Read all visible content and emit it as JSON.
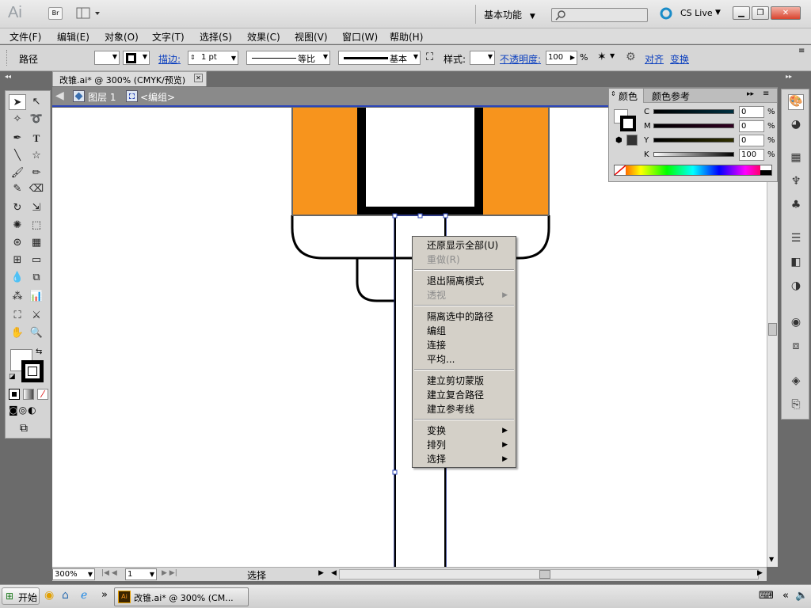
{
  "app": {
    "logo": "Ai",
    "bridge": "Br",
    "workspace": "基本功能",
    "cslive": "CS Live"
  },
  "menubar": [
    "文件(F)",
    "编辑(E)",
    "对象(O)",
    "文字(T)",
    "选择(S)",
    "效果(C)",
    "视图(V)",
    "窗口(W)",
    "帮助(H)"
  ],
  "controlbar": {
    "path_label": "路径",
    "stroke_link": "描边:",
    "stroke_weight": "1 pt",
    "profile": "等比",
    "brush": "基本",
    "style_label": "样式:",
    "opacity_link": "不透明度:",
    "opacity_value": "100",
    "percent": "%",
    "align_link": "对齐",
    "transform_link": "变换"
  },
  "document": {
    "tab_title": "改锥.ai* @ 300% (CMYK/预览)",
    "layer": "图层 1",
    "group": "<编组>",
    "zoom": "300%",
    "page": "1",
    "status": "选择"
  },
  "color_panel": {
    "tab_color": "颜色",
    "tab_guide": "颜色参考",
    "channels": [
      {
        "label": "C",
        "value": "0",
        "color": "#00aeef"
      },
      {
        "label": "M",
        "value": "0",
        "color": "#ec008c"
      },
      {
        "label": "Y",
        "value": "0",
        "color": "#fff200"
      },
      {
        "label": "K",
        "value": "100",
        "color": "#000000"
      }
    ],
    "percent": "%"
  },
  "context_menu": {
    "items": [
      {
        "label": "还原显示全部(U)",
        "enabled": true,
        "submenu": false
      },
      {
        "label": "重做(R)",
        "enabled": false,
        "submenu": false
      },
      {
        "separator": true
      },
      {
        "label": "退出隔离模式",
        "enabled": true,
        "submenu": false
      },
      {
        "label": "透视",
        "enabled": false,
        "submenu": true
      },
      {
        "separator": true
      },
      {
        "label": "隔离选中的路径",
        "enabled": true,
        "submenu": false
      },
      {
        "label": "编组",
        "enabled": true,
        "submenu": false
      },
      {
        "label": "连接",
        "enabled": true,
        "submenu": false
      },
      {
        "label": "平均...",
        "enabled": true,
        "submenu": false
      },
      {
        "separator": true
      },
      {
        "label": "建立剪切蒙版",
        "enabled": true,
        "submenu": false
      },
      {
        "label": "建立复合路径",
        "enabled": true,
        "submenu": false
      },
      {
        "label": "建立参考线",
        "enabled": true,
        "submenu": false
      },
      {
        "separator": true
      },
      {
        "label": "变换",
        "enabled": true,
        "submenu": true
      },
      {
        "label": "排列",
        "enabled": true,
        "submenu": true
      },
      {
        "label": "选择",
        "enabled": true,
        "submenu": true
      }
    ]
  },
  "taskbar": {
    "start": "开始",
    "window_title": "改锥.ai* @ 300% (CM...",
    "more": "»"
  },
  "colors": {
    "orange": "#f7941d",
    "isolation_bar": "#8a8a8a",
    "selection_blue": "#2c45b8"
  }
}
